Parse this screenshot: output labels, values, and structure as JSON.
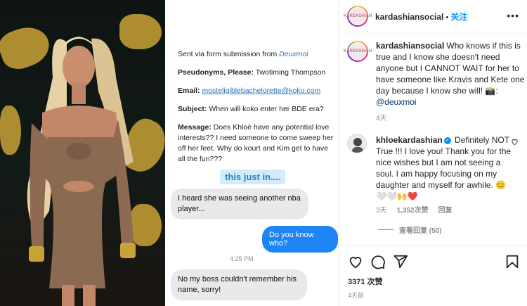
{
  "message": {
    "source_prefix": "Sent via form submission from ",
    "source_link": "Deuxmoi",
    "pseudonym_label": "Pseudonyms, Please:",
    "pseudonym_value": " Twotiming Thompson",
    "email_label": "Email:",
    "email_value": "mosteligiblebachelorette@koko.com",
    "subject_label": "Subject:",
    "subject_value": " When will koko enter her BDE era?",
    "message_label": "Message:",
    "message_value": " Does Khloè have any potential love interests?? I need someone to come sweep her off her feet. Why do kourt and Kim get to have all the fun???",
    "just_in": "this just in....",
    "bubble1": "I heard she was seeing another nba player...",
    "bubble2": "Do you know who?",
    "time": "4:25 PM",
    "bubble3": "No my boss couldn't remember his name, sorry!"
  },
  "post": {
    "username": "kardashiansocial",
    "follow_sep": " • ",
    "follow_label": "关注",
    "more_label": "•••",
    "avatar_text": "KARDASHIAN",
    "caption_user": "kardashiansocial",
    "caption_text": "Who knows if this is true and I know she doesn't need anyone but I CANNOT WAIT for her to have someone like Kravis and Kete one day because I know she will! 📸: ",
    "caption_mention": "@deuxmoi",
    "caption_age": "4天",
    "comment_user": "khloekardashian",
    "verified_mark": "✓",
    "comment_text": " Definitely NOT True !!! I love you! Thank you for the nice wishes but I am not seeing a soul. I am happy focusing on my daughter and myself for awhile. 😊🤍🤍🙌❤️",
    "comment_age": "3天",
    "comment_likes": "1,352次赞",
    "reply_label": "回复",
    "view_replies": "查看回复 (50)",
    "likes": "3371 次赞",
    "post_age": "4天前"
  },
  "icons": [
    "heart-icon",
    "comment-icon",
    "share-icon",
    "bookmark-icon",
    "more-icon",
    "verified-icon"
  ]
}
